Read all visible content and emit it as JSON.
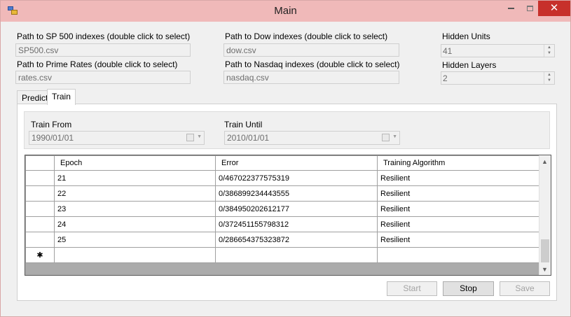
{
  "window": {
    "title": "Main",
    "icons": {
      "app": "app-icon",
      "minimize": "minimize-icon",
      "maximize": "maximize-icon",
      "close": "close-icon"
    },
    "close_glyph": "✕"
  },
  "paths": {
    "sp500": {
      "label": "Path to SP 500 indexes (double click to select)",
      "value": "SP500.csv"
    },
    "dow": {
      "label": "Path to Dow indexes (double click to select)",
      "value": "dow.csv"
    },
    "prime": {
      "label": "Path to Prime Rates (double click to select)",
      "value": "rates.csv"
    },
    "nasdaq": {
      "label": "Path to Nasdaq indexes (double click to select)",
      "value": "nasdaq.csv"
    }
  },
  "network": {
    "hidden_units": {
      "label": "Hidden Units",
      "value": "41"
    },
    "hidden_layers": {
      "label": "Hidden Layers",
      "value": "2"
    }
  },
  "tabs": [
    {
      "label": "Predict",
      "active": false
    },
    {
      "label": "Train",
      "active": true
    }
  ],
  "train": {
    "from": {
      "label": "Train From",
      "value": "1990/01/01"
    },
    "until": {
      "label": "Train Until",
      "value": "2010/01/01"
    }
  },
  "grid": {
    "columns": [
      "Epoch",
      "Error",
      "Training Algorithm"
    ],
    "rows": [
      [
        "21",
        "0/467022377575319",
        "Resilient"
      ],
      [
        "22",
        "0/386899234443555",
        "Resilient"
      ],
      [
        "23",
        "0/384950202612177",
        "Resilient"
      ],
      [
        "24",
        "0/372451155798312",
        "Resilient"
      ],
      [
        "25",
        "0/286654375323872",
        "Resilient"
      ]
    ],
    "new_row_marker": "✱"
  },
  "buttons": {
    "start": {
      "label": "Start",
      "enabled": false
    },
    "stop": {
      "label": "Stop",
      "enabled": true
    },
    "save": {
      "label": "Save",
      "enabled": false
    }
  }
}
